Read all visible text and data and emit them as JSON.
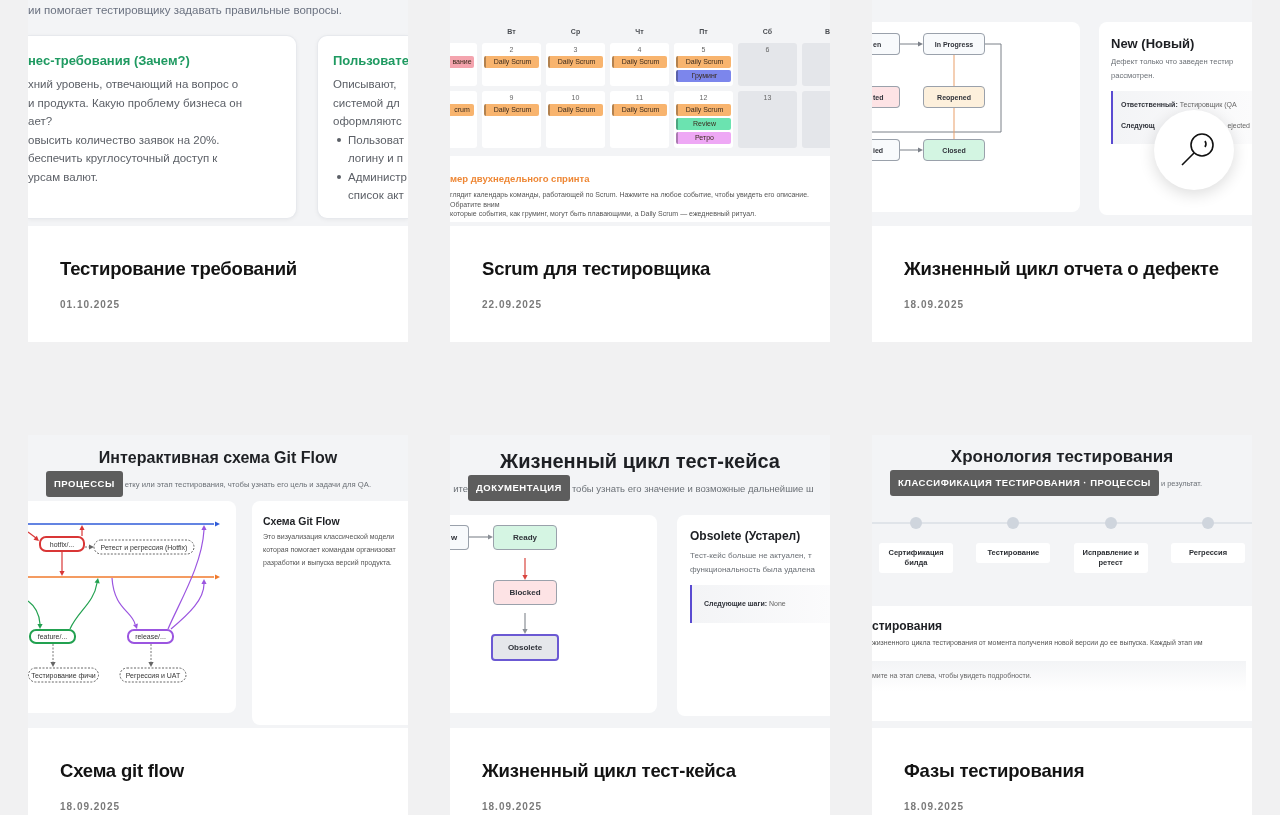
{
  "cards": [
    {
      "title": "Тестирование требований",
      "date": "01.10.2025",
      "preview": {
        "kind": "requirements",
        "intro": "ии помогает тестировщику задавать правильные вопросы.",
        "panels": [
          {
            "heading": "нес-требования (Зачем?)",
            "lines": [
              {
                "kind": "text",
                "text": "хний уровень, отвечающий на вопрос о"
              },
              {
                "kind": "text",
                "text": "и продукта. Какую проблему бизнеса он"
              },
              {
                "kind": "text",
                "text": "ает?"
              },
              {
                "kind": "text",
                "text": "овысить количество заявок на 20%."
              },
              {
                "kind": "text",
                "text": "беспечить круглосуточный доступ к"
              },
              {
                "kind": "text",
                "text": "урсам валют."
              }
            ]
          },
          {
            "heading": "Пользовате",
            "lines": [
              {
                "kind": "text",
                "text": "Описывают,"
              },
              {
                "kind": "text",
                "text": "системой дл"
              },
              {
                "kind": "text",
                "text": "оформляютс"
              },
              {
                "kind": "bullet",
                "text": "Пользоват"
              },
              {
                "kind": "continued",
                "text": "логину и п"
              },
              {
                "kind": "bullet",
                "text": "Администр"
              },
              {
                "kind": "continued",
                "text": "список акт"
              }
            ]
          }
        ]
      }
    },
    {
      "title": "Scrum для тестировщика",
      "date": "22.09.2025",
      "preview": {
        "kind": "scrum_calendar",
        "weekdays": [
          {
            "label": "Вт",
            "weekend": false
          },
          {
            "label": "Ср",
            "weekend": false
          },
          {
            "label": "Чт",
            "weekend": false
          },
          {
            "label": "Пт",
            "weekend": false
          },
          {
            "label": "Сб",
            "weekend": true
          },
          {
            "label": "В",
            "weekend": true
          }
        ],
        "weeks": [
          {
            "lead_events": [
              {
                "label": "вание",
                "color": "#f4a4ae"
              }
            ],
            "days": [
              {
                "number": "2",
                "events": [
                  {
                    "label": "Daily Scrum",
                    "color": "#f8b46e"
                  }
                ]
              },
              {
                "number": "3",
                "events": [
                  {
                    "label": "Daily Scrum",
                    "color": "#f8b46e"
                  }
                ]
              },
              {
                "number": "4",
                "events": [
                  {
                    "label": "Daily Scrum",
                    "color": "#f8b46e"
                  }
                ]
              },
              {
                "number": "5",
                "events": [
                  {
                    "label": "Daily Scrum",
                    "color": "#f8b46e"
                  },
                  {
                    "label": "Груминг",
                    "color": "#7c86ec"
                  }
                ]
              },
              {
                "number": "6"
              }
            ]
          },
          {
            "lead_events": [
              {
                "label": "crum",
                "color": "#f8b46e"
              }
            ],
            "days": [
              {
                "number": "9",
                "events": [
                  {
                    "label": "Daily Scrum",
                    "color": "#f8b46e"
                  }
                ]
              },
              {
                "number": "10",
                "events": [
                  {
                    "label": "Daily Scrum",
                    "color": "#f8b46e"
                  }
                ]
              },
              {
                "number": "11",
                "events": [
                  {
                    "label": "Daily Scrum",
                    "color": "#f8b46e"
                  }
                ]
              },
              {
                "number": "12",
                "events": [
                  {
                    "label": "Daily Scrum",
                    "color": "#f8b46e"
                  },
                  {
                    "label": "Review",
                    "color": "#6be3b0"
                  },
                  {
                    "label": "Ретро",
                    "color": "#eea8f5"
                  }
                ]
              },
              {
                "number": "13"
              }
            ]
          }
        ],
        "note": {
          "heading": "мер двухнедельного спринта",
          "lines": [
            "глядит календарь команды, работающей по Scrum. Нажмите на любое событие, чтобы увидеть его описание. Обратите вним",
            "которые события, как груминг, могут быть плавающими, а Daily Scrum — ежедневный ритуал."
          ]
        }
      }
    },
    {
      "title": "Жизненный цикл отчета о дефекте",
      "date": "18.09.2025",
      "preview": {
        "kind": "defect_lifecycle",
        "nodes": [
          {
            "label": "en",
            "color": "#f8fafc"
          },
          {
            "label": "In Progress",
            "color": "#f8fafc"
          },
          {
            "label": "ted",
            "color": "#fde3e5"
          },
          {
            "label": "Reopened",
            "color": "#fdf0dc"
          },
          {
            "label": "ied",
            "color": "#f8fafc"
          },
          {
            "label": "Closed",
            "color": "#d3f5e2"
          }
        ],
        "detail": {
          "heading": "New (Новый)",
          "lines": [
            "Дефект только что заведен тестир",
            "рассмотрен."
          ],
          "facts": [
            {
              "label": "Ответственный:",
              "value": "Тестировщик (QA"
            },
            {
              "label": "Следующ",
              "tail": "ejected"
            }
          ]
        }
      }
    },
    {
      "title": "Схема git flow",
      "date": "18.09.2025",
      "badge": "ПРОЦЕССЫ",
      "preview": {
        "kind": "git_flow",
        "heading": "Интерактивная схема Git Flow",
        "subtitle": {
          "after": "етку или этап тестирования, чтобы узнать его цель и задачи для QA."
        },
        "branches": [
          {
            "label": "hotfix/...",
            "color": "#d93636"
          },
          {
            "label": "feature/...",
            "color": "#22a150"
          },
          {
            "label": "release/...",
            "color": "#9b55e0"
          }
        ],
        "stages": [
          {
            "label": "Ретест и регрессия (Hotfix)"
          },
          {
            "label": "Тестирование фичи"
          },
          {
            "label": "Регрессия и UAT"
          }
        ],
        "detail": {
          "heading": "Схема Git Flow",
          "lines": [
            "Это визуализация классической модели",
            "которая помогает командам организоват",
            "разработки и выпуска версий продукта."
          ]
        }
      }
    },
    {
      "title": "Жизненный цикл тест-кейса",
      "date": "18.09.2025",
      "badge": "ДОКУМЕНТАЦИЯ",
      "preview": {
        "kind": "testcase_lifecycle",
        "heading": "Жизненный цикл тест-кейса",
        "subtitle": {
          "before": "ите",
          "after": "тобы узнать его значение и возможные дальнейшие ш"
        },
        "nodes": [
          {
            "label": "w",
            "color": "#f8fafc",
            "selected": false
          },
          {
            "label": "Ready",
            "color": "#d5f5e3",
            "selected": false
          },
          {
            "label": "Blocked",
            "color": "#fde3e5",
            "selected": false
          },
          {
            "label": "Obsolete",
            "color": "#e5e7eb",
            "selected": true
          }
        ],
        "detail": {
          "heading": "Obsolete (Устарел)",
          "lines": [
            "Тест-кейс больше не актуален, т",
            "функциональность была удалена"
          ],
          "facts": [
            {
              "label": "Следующие шаги:",
              "value": "None"
            }
          ]
        }
      }
    },
    {
      "title": "Фазы тестирования",
      "date": "18.09.2025",
      "badge": "КЛАССИФИКАЦИЯ ТЕСТИРОВАНИЯ · ПРОЦЕССЫ",
      "preview": {
        "kind": "timeline",
        "heading": "Хронология тестирования",
        "subtitle": {
          "after": "и результат."
        },
        "stages": [
          {
            "label": "Сертификация билда"
          },
          {
            "label": "Тестирование"
          },
          {
            "label": "Исправление и ретест"
          },
          {
            "label": "Регрессия"
          }
        ],
        "panel": {
          "heading": "стирования",
          "lines": [
            "жизненного цикла тестирования от момента получения новой версии до ее выпуска. Каждый этап им"
          ],
          "hint": "мите на этап слева, чтобы увидеть подробности."
        }
      }
    }
  ]
}
